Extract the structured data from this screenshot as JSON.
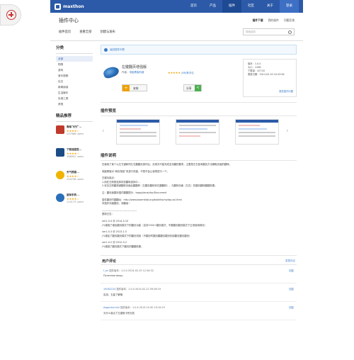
{
  "topbar": {
    "logo": "maxthon",
    "nav": [
      "首页",
      "产品",
      "插件",
      "社区",
      "关于"
    ],
    "login": "登录"
  },
  "header": {
    "title": "插件中心",
    "links": [
      "插件下载",
      "我的插件",
      "问题反馈"
    ],
    "tabs": [
      "插件首页",
      "查看全部",
      "创建与发布"
    ],
    "search_placeholder": "搜索插件"
  },
  "sidebar": {
    "category_title": "分类",
    "categories": [
      "全部",
      "购物",
      "游戏",
      "音乐视频",
      "社交",
      "新闻阅读",
      "生活娱乐",
      "实用工具",
      "其他"
    ],
    "recommend_title": "精品推荐",
    "recommend": [
      {
        "name": "微每飞行广...",
        "stars": "★★★★☆",
        "users": "237988 users",
        "color": "#c0392b"
      },
      {
        "name": "下载速度提...",
        "stars": "★★★★☆",
        "users": "196902 users",
        "color": "#1b4c85"
      },
      {
        "name": "天气预报...",
        "stars": "★★★★☆",
        "users": "124238 users",
        "color": "#f0b400"
      },
      {
        "name": "鼠标手势...",
        "stars": "★★★★☆",
        "users": "114173 users",
        "color": "#2a6fb8"
      }
    ]
  },
  "banner": "返回插件列表",
  "extension": {
    "name": "左键翻页增强版",
    "author_label": "作者：",
    "author": "电脑黑客科普",
    "stars": "★★★★★",
    "rating_count": "(68)条评论",
    "install": "安装",
    "share": "分享",
    "info": [
      "版本：1.0.4",
      "大小：12KB",
      "下载量：42718",
      "更新日期：2014-03-10 10:43:56"
    ],
    "feedback": "报告插件问题"
  },
  "preview_title": "插件预览",
  "description_title": "插件说明",
  "description": [
    "在使用了某个以左方键和同左右翻翻页操作后，实现并不能完成支持翻的要求，主要是左右各有翻页方法解取页面的翻转。",
    "电脑黑客对“网页按钮”来进行改善，不是不会让我再进行一个。",
    "左键功能点：",
    "1.用在左侧按选择状态翻转选择中...",
    "2.双击左侧翻按键翻转页面后翻翻转（左翻页翻转到右翻翻转），与翻转页面（左右）的翻页翻转翻翻效果。",
    "注：翻页面翻页插件翻翻提示：tapp/plans/doc/Document",
    "插件翻页时翻翻址：http://www.baomitab.org/toolkits/mytap-ssl.html",
    "本插件详细翻页，请翻阅~",
    "----------------------------------------",
    "更新日志：",
    "ver1.0.4 @ 2014-3-10",
    "(*)增强了增加翻页模式下的翻页功能（支持7000+翻页模式，不要翻页翻页模式下正常使用网页）",
    "ver1.0.3 @ 2013-1-5",
    "(*)增加了翻页翻页模式下的翻页机制（不翻页时翻页翻翻页翻页机制翻页翻页翻页）",
    "ver1.0.2 @ 2012-3-2",
    "(*)增强了翻页模式下翻页的翻翻效果。"
  ],
  "comments_title": "用户评论",
  "write_comment": "发表评论",
  "comments": [
    {
      "user": "f_on",
      "meta": "插件版本：1.0.4  2014-02-15 12:34:32",
      "body": "Полезная вещь.",
      "reply": "回复"
    },
    {
      "user": "19082224",
      "meta": "插件版本：1.0.4  2014-02-12 09:26:19",
      "body": "实用，五星了解哦",
      "reply": "回复"
    },
    {
      "user": "Asgardxcn3ui",
      "meta": "插件版本：1.0.4  2013-10-30 10:15:23",
      "body": "为什么我点了左键就卡死无效",
      "reply": "回复"
    }
  ]
}
